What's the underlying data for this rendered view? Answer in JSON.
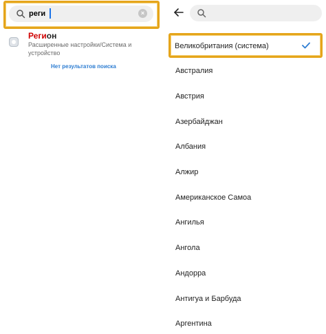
{
  "left": {
    "search": {
      "query": "реги",
      "clear_icon": "close-icon"
    },
    "result": {
      "title_match": "Реги",
      "title_rest": "он",
      "description": "Расширенные настройки/Система и устройство"
    },
    "no_results": "Нет результатов поиска"
  },
  "right": {
    "regions": [
      {
        "label": "Великобритания (система)",
        "selected": true
      },
      {
        "label": "Австралия"
      },
      {
        "label": "Австрия"
      },
      {
        "label": "Азербайджан"
      },
      {
        "label": "Албания"
      },
      {
        "label": "Алжир"
      },
      {
        "label": "Американское Самоа"
      },
      {
        "label": "Ангилья"
      },
      {
        "label": "Ангола"
      },
      {
        "label": "Андорра"
      },
      {
        "label": "Антигуа и Барбуда"
      },
      {
        "label": "Аргентина"
      }
    ]
  },
  "colors": {
    "highlight": "#e5a51b",
    "accent": "#2d7dd2",
    "match": "#d00000"
  }
}
